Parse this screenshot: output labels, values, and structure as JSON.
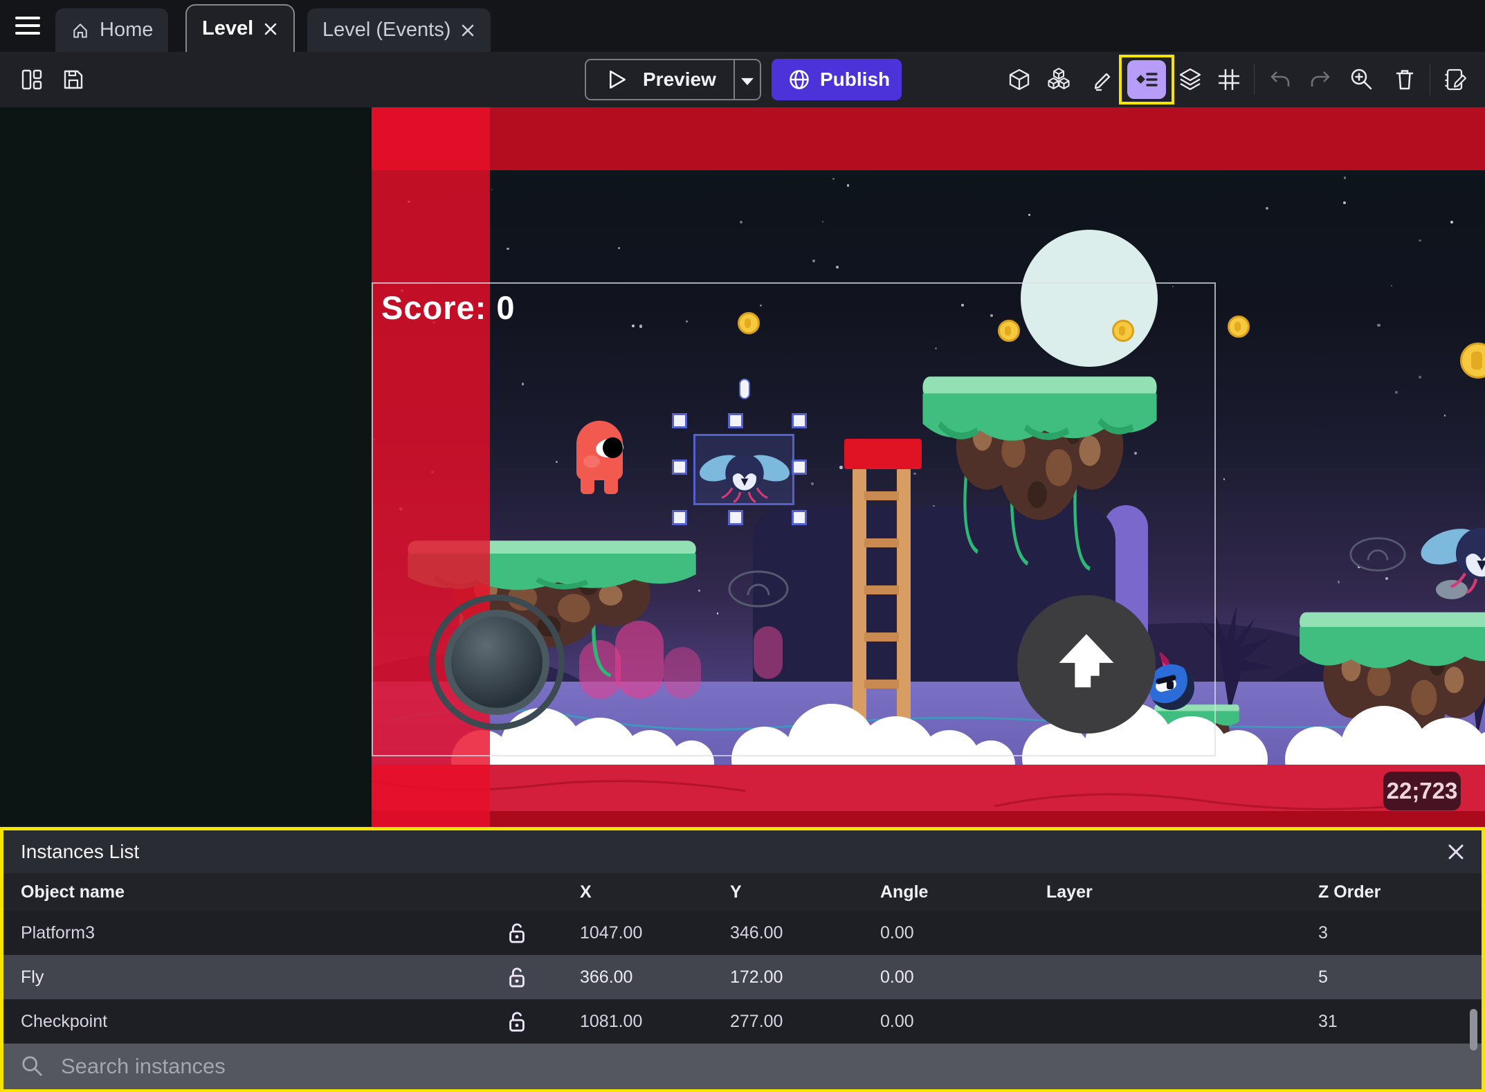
{
  "tabs": {
    "home": "Home",
    "level": "Level",
    "level_events": "Level (Events)"
  },
  "toolbar": {
    "preview": "Preview",
    "publish": "Publish"
  },
  "scene": {
    "score": "Score: 0",
    "coordinates": "22;723"
  },
  "instances_panel": {
    "title": "Instances List",
    "columns": [
      "Object name",
      "X",
      "Y",
      "Angle",
      "Layer",
      "Z Order"
    ],
    "rows": [
      {
        "name": "Platform3",
        "x": "1047.00",
        "y": "346.00",
        "angle": "0.00",
        "layer": "",
        "z_order": "3",
        "selected": false
      },
      {
        "name": "Fly",
        "x": "366.00",
        "y": "172.00",
        "angle": "0.00",
        "layer": "",
        "z_order": "5",
        "selected": true
      },
      {
        "name": "Checkpoint",
        "x": "1081.00",
        "y": "277.00",
        "angle": "0.00",
        "layer": "",
        "z_order": "31",
        "selected": false
      }
    ],
    "search_placeholder": "Search instances"
  },
  "icons": [
    "menu-icon",
    "home-icon",
    "close-icon",
    "layout-icon",
    "save-icon",
    "play-icon",
    "chevron-down-icon",
    "globe-icon",
    "cube-icon",
    "objects-icon",
    "pencil-icon",
    "instances-list-icon",
    "layers-icon",
    "grid-icon",
    "undo-icon",
    "redo-icon",
    "zoom-in-icon",
    "trash-icon",
    "edit-scene-icon",
    "lock-open-icon",
    "search-icon"
  ],
  "colors": {
    "accent": "#4b32d9",
    "highlight_yellow": "#f7e400",
    "selection_blue": "#5560cf",
    "danger_red": "#d40e26",
    "instances_icon_bg": "#b79df8"
  }
}
